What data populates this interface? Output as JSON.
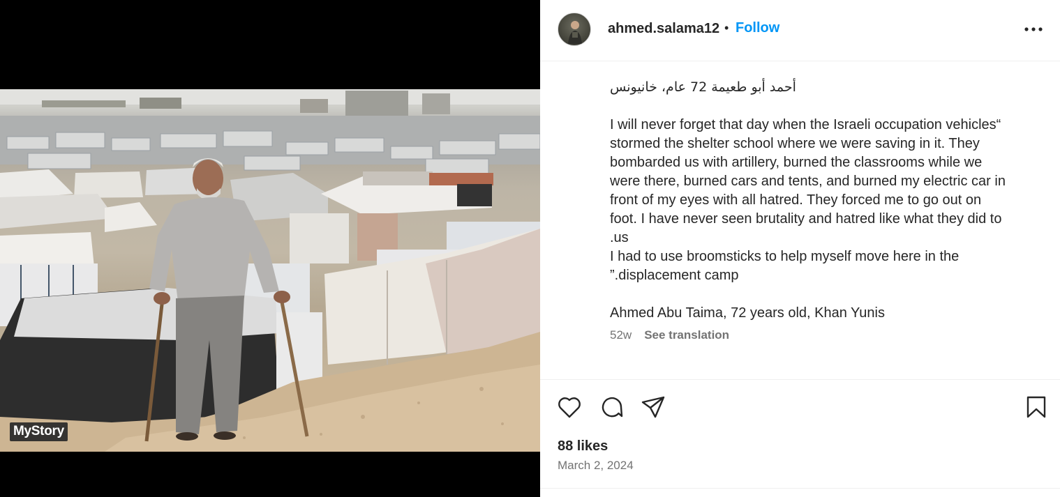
{
  "media": {
    "overlay_brand": "MyStory",
    "alt": "Elderly man walking with two sticks through a sandy displacement camp filled with tents"
  },
  "header": {
    "username": "ahmed.salama12",
    "separator": "•",
    "follow_label": "Follow",
    "more_icon": "more-horizontal-icon"
  },
  "caption": {
    "lines": [
      "أحمد أبو طعيمة 72 عام، خانيونس",
      "",
      "I will never forget that day when the Israeli occupation vehicles“",
      "stormed the shelter school where we were saving in it. They",
      "bombarded us with artillery, burned the classrooms while we",
      "were there, burned cars and tents, and burned my electric car in",
      "front of my eyes with all hatred. They forced me to go out on",
      "foot. I have never seen brutality and hatred like what they did to",
      ".us",
      "I had to use broomsticks to help myself move here in the",
      "”.displacement camp",
      "",
      "Ahmed Abu Taima, 72 years old, Khan Yunis"
    ],
    "age": "52w",
    "see_translation": "See translation"
  },
  "actions": {
    "like_icon": "heart-icon",
    "comment_icon": "comment-icon",
    "share_icon": "share-icon",
    "save_icon": "bookmark-icon"
  },
  "stats": {
    "likes": "88 likes",
    "date": "March 2, 2024"
  },
  "colors": {
    "accent": "#0095f6",
    "text": "#262626",
    "secondary": "#737373",
    "divider": "#efefef"
  }
}
